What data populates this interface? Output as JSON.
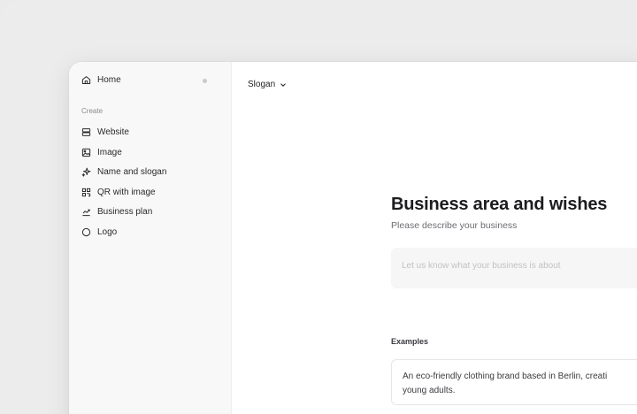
{
  "sidebar": {
    "home_label": "Home",
    "section_label": "Create",
    "items": [
      {
        "label": "Website",
        "icon": "website-icon"
      },
      {
        "label": "Image",
        "icon": "image-icon"
      },
      {
        "label": "Name and slogan",
        "icon": "sparkle-icon"
      },
      {
        "label": "QR with image",
        "icon": "qr-icon"
      },
      {
        "label": "Business plan",
        "icon": "chart-icon"
      },
      {
        "label": "Logo",
        "icon": "circle-icon"
      }
    ]
  },
  "header": {
    "dropdown_label": "Slogan"
  },
  "form": {
    "title": "Business area and wishes",
    "subtitle": "Please describe your business",
    "input_placeholder": "Let us know what your business is about",
    "input_value": ""
  },
  "examples": {
    "label": "Examples",
    "items": [
      {
        "line1": "An eco-friendly clothing brand based in Berlin, creati",
        "line2": "young adults."
      }
    ]
  },
  "colors": {
    "background": "#ebebeb",
    "sidebar": "#f8f8f8",
    "window": "#ffffff",
    "input_bg": "#f6f6f6"
  }
}
